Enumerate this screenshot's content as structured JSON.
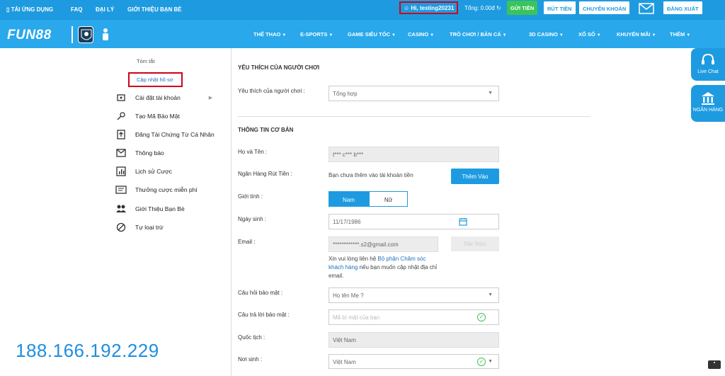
{
  "top": {
    "app": "TẢI ỨNG DỤNG",
    "faq": "FAQ",
    "agent": "ĐẠI LÝ",
    "referral": "GIỚI THIỆU BẠN BÈ",
    "hello": "Hi, testing20231",
    "total": "Tổng: 0.00đ",
    "deposit": "GỬI TIỀN",
    "withdraw": "RÚT TIỀN",
    "transfer": "CHUYỂN KHOẢN",
    "logout": "ĐĂNG XUẤT"
  },
  "brand": {
    "logo": "FUN88"
  },
  "nav": [
    {
      "label": "THỂ THAO"
    },
    {
      "label": "E-SPORTS"
    },
    {
      "label": "GAME SIÊU TỐC"
    },
    {
      "label": "CASINO"
    },
    {
      "label": "TRÒ CHƠI / BẮN CÁ"
    },
    {
      "label": "3D CASINO"
    },
    {
      "label": "XỔ SỐ"
    },
    {
      "label": "KHUYẾN MÃI"
    },
    {
      "label": "THÊM"
    }
  ],
  "sidebar": {
    "summary": "Tóm tắt",
    "update_profile": "Cập nhật hồ sơ",
    "items": [
      {
        "label": "Cài đặt tài khoản",
        "icon": "gear-icon"
      },
      {
        "label": "Tạo Mã Bảo Mật",
        "icon": "key-icon"
      },
      {
        "label": "Đăng Tải Chứng Từ Cá Nhân",
        "icon": "upload-icon"
      },
      {
        "label": "Thông báo",
        "icon": "mail-icon"
      },
      {
        "label": "Lịch sử Cược",
        "icon": "chart-icon"
      },
      {
        "label": "Thưởng cược miễn phí",
        "icon": "ticket-icon"
      },
      {
        "label": "Giới Thiệu Bạn Bè",
        "icon": "users-icon"
      },
      {
        "label": "Tự loại trừ",
        "icon": "ban-icon"
      }
    ]
  },
  "form": {
    "pref_title": "YÊU THÍCH CỦA NGƯỜI CHƠI",
    "pref_label": "Yêu thích của người chơi :",
    "pref_value": "Tổng hợp",
    "basic_title": "THÔNG TIN CƠ BẢN",
    "name_label": "Họ và Tên :",
    "name_value": "t*** c*** b***",
    "bank_label": "Ngân Hàng Rút Tiền :",
    "bank_text": "Bạn chưa thêm vào tài khoản tiền",
    "add_button": "Thêm Vào",
    "gender_label": "Giới tính :",
    "gender_male": "Nam",
    "gender_female": "Nữ",
    "dob_label": "Ngày sinh :",
    "dob_value": "11/17/1986",
    "email_label": "Email :",
    "email_value": "************.s2@gmail.com",
    "verify_button": "Xác thực",
    "note_a": "Xin vui lòng liên hệ ",
    "note_link": "Bộ phận Chăm sóc khách hàng",
    "note_b": " nếu bạn muốn cập nhật địa chỉ email.",
    "q_label": "Câu hỏi bảo mật :",
    "q_value": "Họ tên Mẹ ?",
    "a_label": "Câu trả lời bảo mật :",
    "a_placeholder": "Mã bí mật của bạn",
    "nat_label": "Quốc tịch :",
    "nat_value": "Việt Nam",
    "birth_label": "Nơi sinh :",
    "birth_value": "Việt Nam"
  },
  "side_tabs": {
    "live_chat": "Live Chat",
    "bank": "NGÂN HÀNG"
  },
  "overlay": {
    "ip": "188.166.192.229"
  },
  "colors": {
    "primary": "#1e9be0",
    "green": "#3bc45a",
    "highlight": "#d0021b"
  }
}
